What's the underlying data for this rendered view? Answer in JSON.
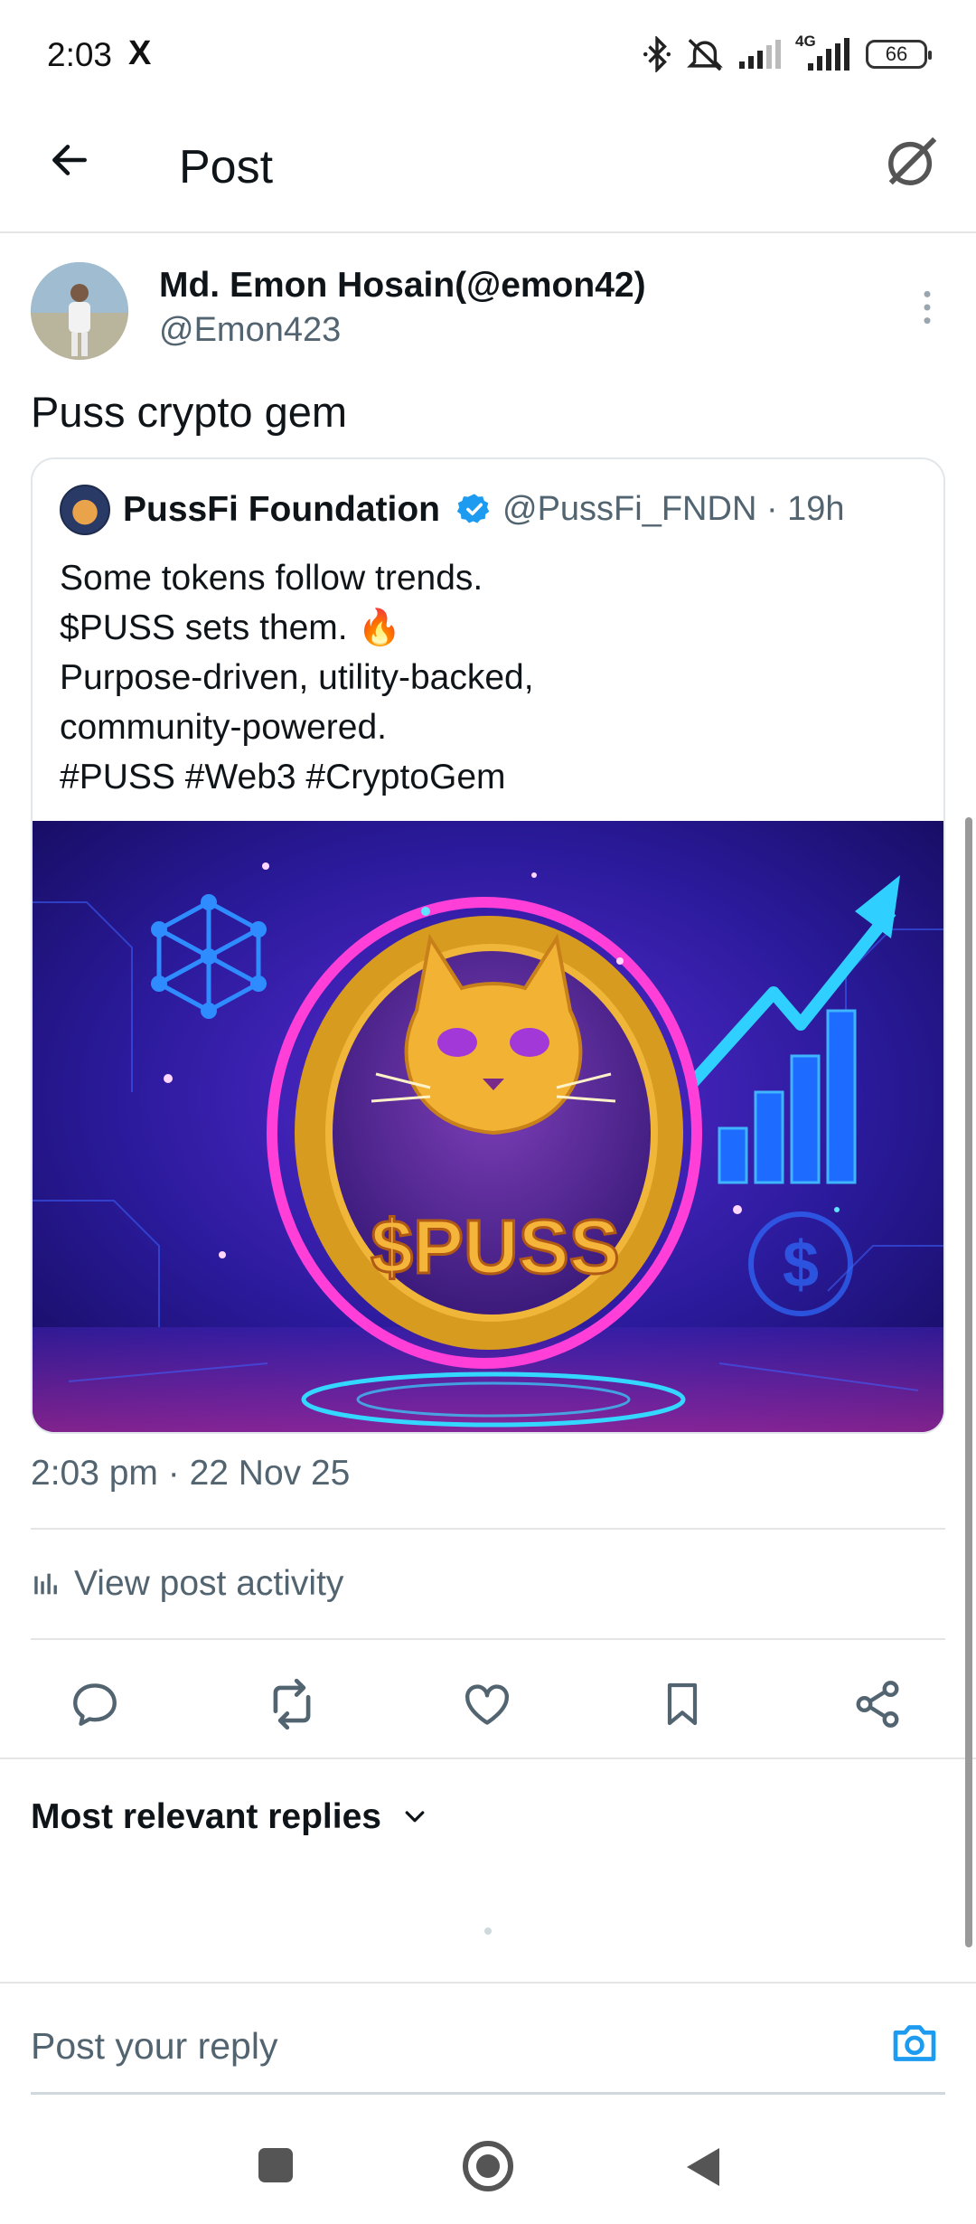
{
  "status_bar": {
    "time": "2:03",
    "app_icon": "X",
    "network": "4G",
    "battery": "66"
  },
  "header": {
    "title": "Post",
    "back_icon": "arrow-left-icon",
    "grok_icon": "grok-icon"
  },
  "post": {
    "author_name": "Md. Emon Hosain(@emon42)",
    "author_handle": "@Emon423",
    "text": "Puss crypto gem",
    "timestamp": "2:03 pm · 22 Nov 25",
    "view_activity_label": "View post activity"
  },
  "quoted_post": {
    "name": "PussFi Foundation",
    "handle_time": "@PussFi_FNDN · 19h",
    "lines": [
      "Some tokens follow trends.",
      "$PUSS sets them. 🔥",
      "Purpose-driven, utility-backed,",
      "community-powered.",
      "#PUSS #Web3 #CryptoGem"
    ],
    "image_text": "$PUSS"
  },
  "actions": [
    "reply-icon",
    "repost-icon",
    "like-icon",
    "bookmark-icon",
    "share-icon"
  ],
  "replies": {
    "sort_label": "Most relevant replies"
  },
  "composer": {
    "placeholder": "Post your reply"
  },
  "colors": {
    "accent": "#1d9bf0",
    "text_primary": "#0f1419",
    "text_secondary": "#536471"
  }
}
